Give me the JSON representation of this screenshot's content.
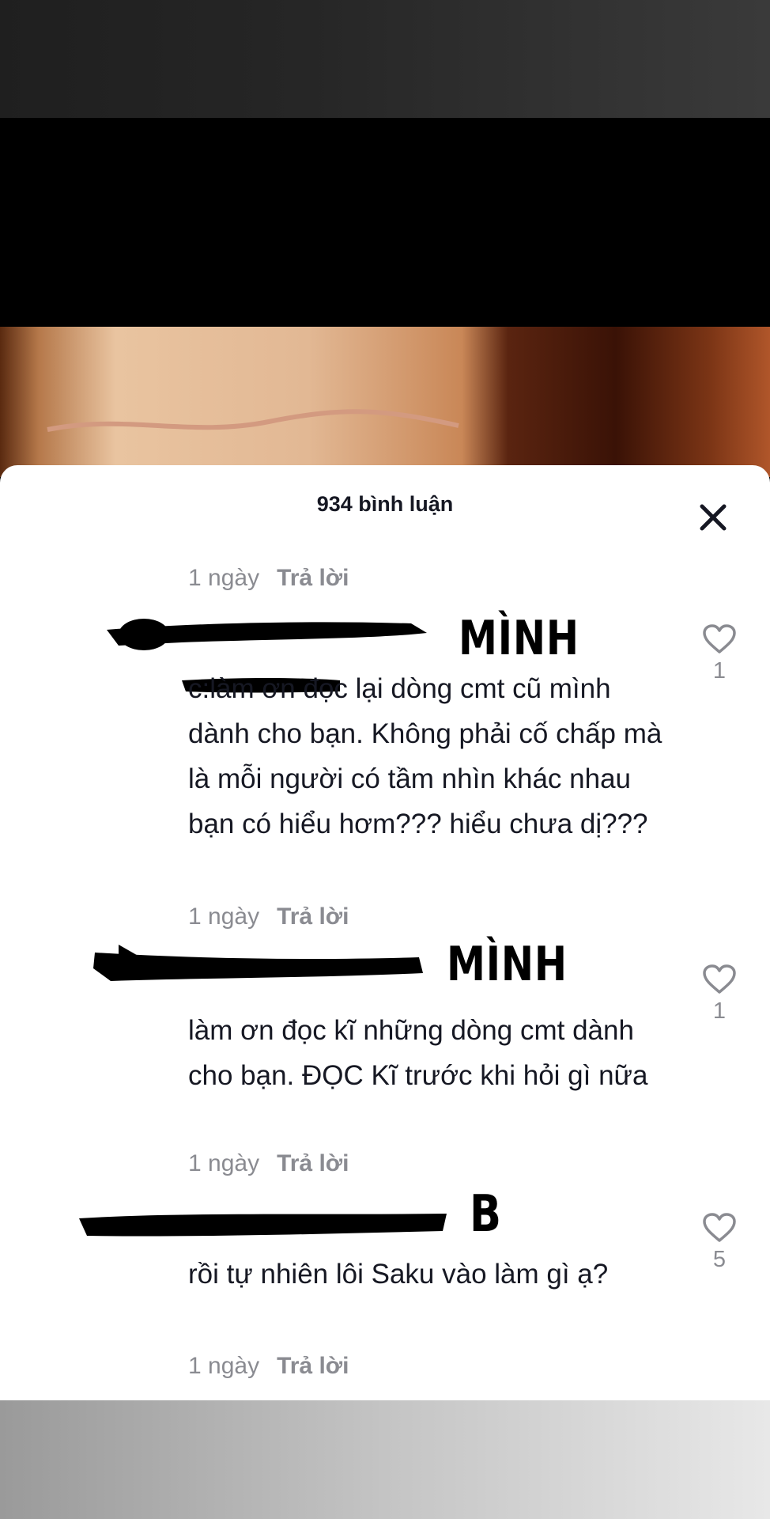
{
  "comments_sheet": {
    "title": "934 bình luận"
  },
  "top_meta": {
    "time": "1 ngày",
    "reply": "Trả lời"
  },
  "comments": [
    {
      "name_tag": "MÌNH",
      "text": "c:làm ơn đọc lại dòng cmt cũ mình dành cho bạn. Không phải cố chấp mà là mỗi người có tầm nhìn khác nhau bạn có hiểu hơm??? hiểu chưa dị???",
      "time": "1 ngày",
      "reply": "Trả lời",
      "likes": "1"
    },
    {
      "name_tag": "MÌNH",
      "text": "làm ơn đọc kĩ những dòng cmt dành cho bạn. ĐỌC Kĩ trước khi hỏi gì nữa",
      "time": "1 ngày",
      "reply": "Trả lời",
      "likes": "1"
    },
    {
      "name_tag": "B",
      "text": "rồi tự nhiên lôi Saku vào làm gì ạ?",
      "time": "1 ngày",
      "reply": "Trả lời",
      "likes": "5"
    }
  ],
  "icons": {
    "close": "close-icon",
    "like": "heart-outline-icon"
  },
  "colors": {
    "primary_text": "#161823",
    "secondary_text": "#8a8b91",
    "redaction": "#000000"
  }
}
